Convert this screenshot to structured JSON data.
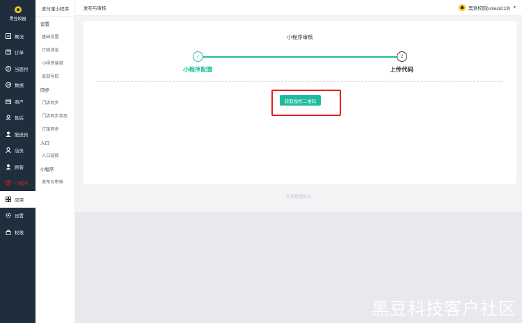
{
  "app": {
    "logo_text": "黑豆校园"
  },
  "sidebar": {
    "items": [
      {
        "label": "概况",
        "icon": "dashboard-icon"
      },
      {
        "label": "订单",
        "icon": "order-icon"
      },
      {
        "label": "当面付",
        "icon": "payment-icon"
      },
      {
        "label": "数据",
        "icon": "data-icon"
      },
      {
        "label": "商户",
        "icon": "store-icon"
      },
      {
        "label": "售后",
        "icon": "after-sales-icon"
      },
      {
        "label": "配送员",
        "icon": "courier-icon"
      },
      {
        "label": "店员",
        "icon": "clerk-icon"
      },
      {
        "label": "顾客",
        "icon": "customer-icon"
      },
      {
        "label": "小程序",
        "icon": "miniapp-icon"
      },
      {
        "label": "应用",
        "icon": "apps-icon"
      },
      {
        "label": "设置",
        "icon": "settings-icon"
      },
      {
        "label": "权限",
        "icon": "lock-icon"
      }
    ]
  },
  "submenu": {
    "title": "支付宝小程序",
    "groups": [
      {
        "label": "设置",
        "items": [
          "基础设置",
          "订阅消息",
          "小程序装修",
          "底部导航"
        ]
      },
      {
        "label": "同步",
        "items": [
          "门店同步",
          "门店同步状态",
          "订单同步"
        ]
      },
      {
        "label": "入口",
        "items": [
          "入口链接"
        ]
      },
      {
        "label": "小程序",
        "items": [
          "发布与审核"
        ]
      }
    ]
  },
  "topbar": {
    "breadcrumb": "发布与审核",
    "user": "黑豆校园(uniacid:19)"
  },
  "main": {
    "title": "小程序审核",
    "step1": {
      "num": "✓",
      "label": "小程序配置"
    },
    "step2": {
      "num": "2",
      "label": "上传代码"
    },
    "button_label": "获取授权二维码",
    "footer": "外卖管理后台"
  },
  "watermark": "黑豆科技客户社区",
  "colors": {
    "sidebar_bg": "#1f2d3d",
    "accent": "#1cbb9b",
    "highlight": "#e02020"
  }
}
